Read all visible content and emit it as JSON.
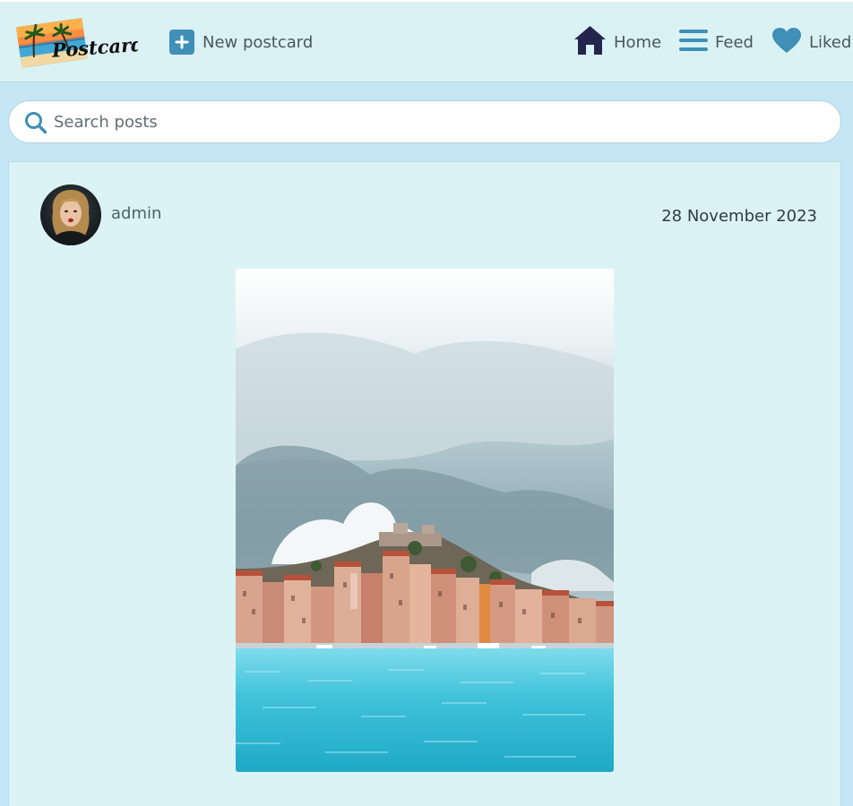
{
  "app": {
    "logo_text": "Postcards"
  },
  "nav": {
    "new_post_label": "New postcard",
    "home_label": "Home",
    "feed_label": "Feed",
    "liked_label": "Liked"
  },
  "search": {
    "placeholder": "Search posts",
    "value": ""
  },
  "post": {
    "author": "admin",
    "date": "28 November 2023"
  },
  "colors": {
    "accent": "#3f8fb6",
    "home_icon": "#23254f",
    "navbar_bg": "#dbf2f5",
    "page_bg": "#c5e6f4",
    "card_bg": "#dcf3f6"
  },
  "icons": {
    "new_post": "plus-square-icon",
    "home": "house-icon",
    "feed": "bars-icon",
    "liked": "heart-icon",
    "search": "magnifier-icon"
  }
}
